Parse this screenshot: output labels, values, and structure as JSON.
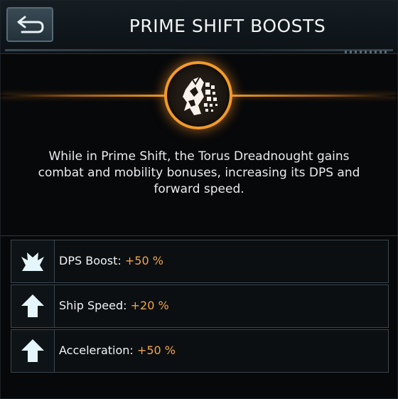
{
  "header": {
    "title": "PRIME SHIFT BOOSTS",
    "back_icon": "back-arrow-icon"
  },
  "emblem": {
    "icon": "torus-dreadnought-prime-shift-icon",
    "accent_color": "#f19a2c"
  },
  "description": "While in Prime Shift, the Torus Dreadnought gains combat and mobility bonuses, increasing its DPS and forward speed.",
  "boosts": [
    {
      "icon": "burst-icon",
      "label": "DPS Boost:",
      "value": "+50 %"
    },
    {
      "icon": "arrow-up-icon",
      "label": "Ship Speed:",
      "value": "+20 %"
    },
    {
      "icon": "arrow-up-icon",
      "label": "Acceleration:",
      "value": "+50 %"
    }
  ],
  "colors": {
    "value_orange": "#f3a447",
    "icon_cyan": "#e4f6fb"
  }
}
